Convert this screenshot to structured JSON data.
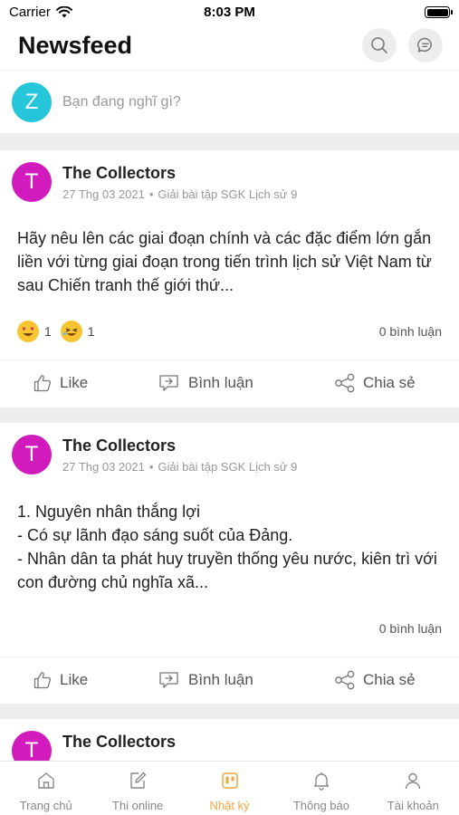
{
  "status_bar": {
    "carrier": "Carrier",
    "time": "8:03 PM"
  },
  "header": {
    "title": "Newsfeed",
    "search_icon": "search-icon",
    "chat_icon": "chat-icon"
  },
  "composer": {
    "avatar_letter": "Z",
    "avatar_color": "#26c6da",
    "placeholder": "Bạn đang nghĩ gì?"
  },
  "posts": [
    {
      "avatar_letter": "T",
      "avatar_color": "#d11bbd",
      "author": "The Collectors",
      "date": "27 Thg 03 2021",
      "category": "Giải bài tập SGK Lịch sử 9",
      "body": "Hãy nêu lên các giai đoạn chính và các đặc điểm lớn gắn liền với từng giai đoạn trong tiến trình lịch sử Việt Nam từ sau Chiến tranh thế giới thứ...",
      "reactions": [
        {
          "icon": "heart-eyes-emoji",
          "count": "1"
        },
        {
          "icon": "laughing-emoji",
          "count": "1"
        }
      ],
      "comments": "0 bình luận",
      "actions": {
        "like": "Like",
        "comment": "Bình luận",
        "share": "Chia sẻ"
      }
    },
    {
      "avatar_letter": "T",
      "avatar_color": "#d11bbd",
      "author": "The Collectors",
      "date": "27 Thg 03 2021",
      "category": "Giải bài tập SGK Lịch sử 9",
      "body": "1. Nguyên nhân thắng lợi\n- Có sự lãnh đạo sáng suốt của Đảng.\n- Nhân dân ta phát huy truyền thống yêu nước, kiên trì với con đường chủ nghĩa xã...",
      "comments": "0 bình luận",
      "actions": {
        "like": "Like",
        "comment": "Bình luận",
        "share": "Chia sẻ"
      }
    },
    {
      "avatar_letter": "T",
      "avatar_color": "#d11bbd",
      "author": "The Collectors"
    }
  ],
  "tabbar": {
    "active_color": "#f0a63c",
    "items": [
      {
        "label": "Trang chủ",
        "icon": "home-icon"
      },
      {
        "label": "Thi online",
        "icon": "edit-icon"
      },
      {
        "label": "Nhật ký",
        "icon": "board-icon"
      },
      {
        "label": "Thông báo",
        "icon": "bell-icon"
      },
      {
        "label": "Tài khoản",
        "icon": "user-icon"
      }
    ]
  }
}
